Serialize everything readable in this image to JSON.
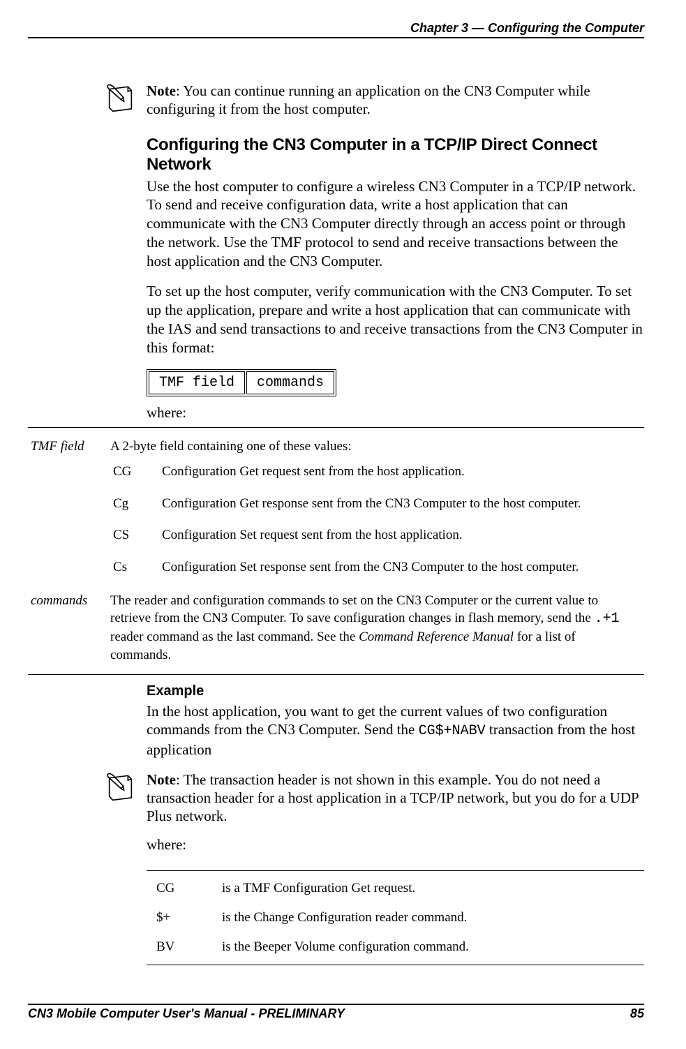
{
  "header": "Chapter 3 —  Configuring the Computer",
  "note1_prefix": "Note",
  "note1_text": ": You can continue running an application on the CN3 Computer while configuring it from the host computer.",
  "section_title": "Configuring the CN3 Computer in a TCP/IP Direct Connect Network",
  "p1": "Use the host computer to configure a wireless CN3 Computer in a TCP/IP network. To send and receive configuration data, write a host application that can communicate with the CN3 Computer directly through an access point or through the network. Use the TMF protocol to send and receive transactions between the host application and the CN3 Computer.",
  "p2": "To set up the host computer, verify communication with the CN3 Computer. To set up the application, prepare and write a host application that can communicate with the IAS and send transactions to and receive transactions from the CN3 Computer in this format:",
  "tmf_field_label": "TMF field",
  "tmf_commands_label": "commands",
  "where_label": "where:",
  "def_tmf_label": "TMF field",
  "def_tmf_desc": "A 2-byte field containing one of these values:",
  "sub": [
    {
      "code": "CG",
      "desc": "Configuration Get request sent from the host application."
    },
    {
      "code": "Cg",
      "desc": "Configuration Get response sent from the CN3 Computer to the host computer."
    },
    {
      "code": "CS",
      "desc": "Configuration Set request sent from the host application."
    },
    {
      "code": "Cs",
      "desc": "Configuration Set response sent from the CN3 Computer to the host computer."
    }
  ],
  "def_commands_label": "commands",
  "def_commands_desc_a": "The reader and configuration commands to set on the CN3 Computer or the current value to retrieve from the CN3 Computer. To save configuration changes in flash memory, send the ",
  "def_commands_code": ".+1",
  "def_commands_desc_b": " reader command as the last command. See the ",
  "def_commands_em": "Command Reference Manual",
  "def_commands_desc_c": " for a list of commands.",
  "example_h": "Example",
  "example_p_a": "In the host application, you want to get the current values of two configuration commands from the CN3 Computer. Send the ",
  "example_code": "CG$+NABV",
  "example_p_b": " transaction from the host application",
  "note2_prefix": "Note",
  "note2_text": ": The transaction header is not shown in this example. You do not need a transaction header for a host application in a TCP/IP network, but you do for a UDP Plus network.",
  "where2_label": "where:",
  "small_defs": [
    {
      "code": "CG",
      "desc": "is a TMF Configuration Get request."
    },
    {
      "code": "$+",
      "desc": "is the Change Configuration reader command."
    },
    {
      "code": "BV",
      "desc": "is the Beeper Volume configuration command."
    }
  ],
  "footer_left": "CN3 Mobile Computer User's Manual - PRELIMINARY",
  "footer_right": "85"
}
